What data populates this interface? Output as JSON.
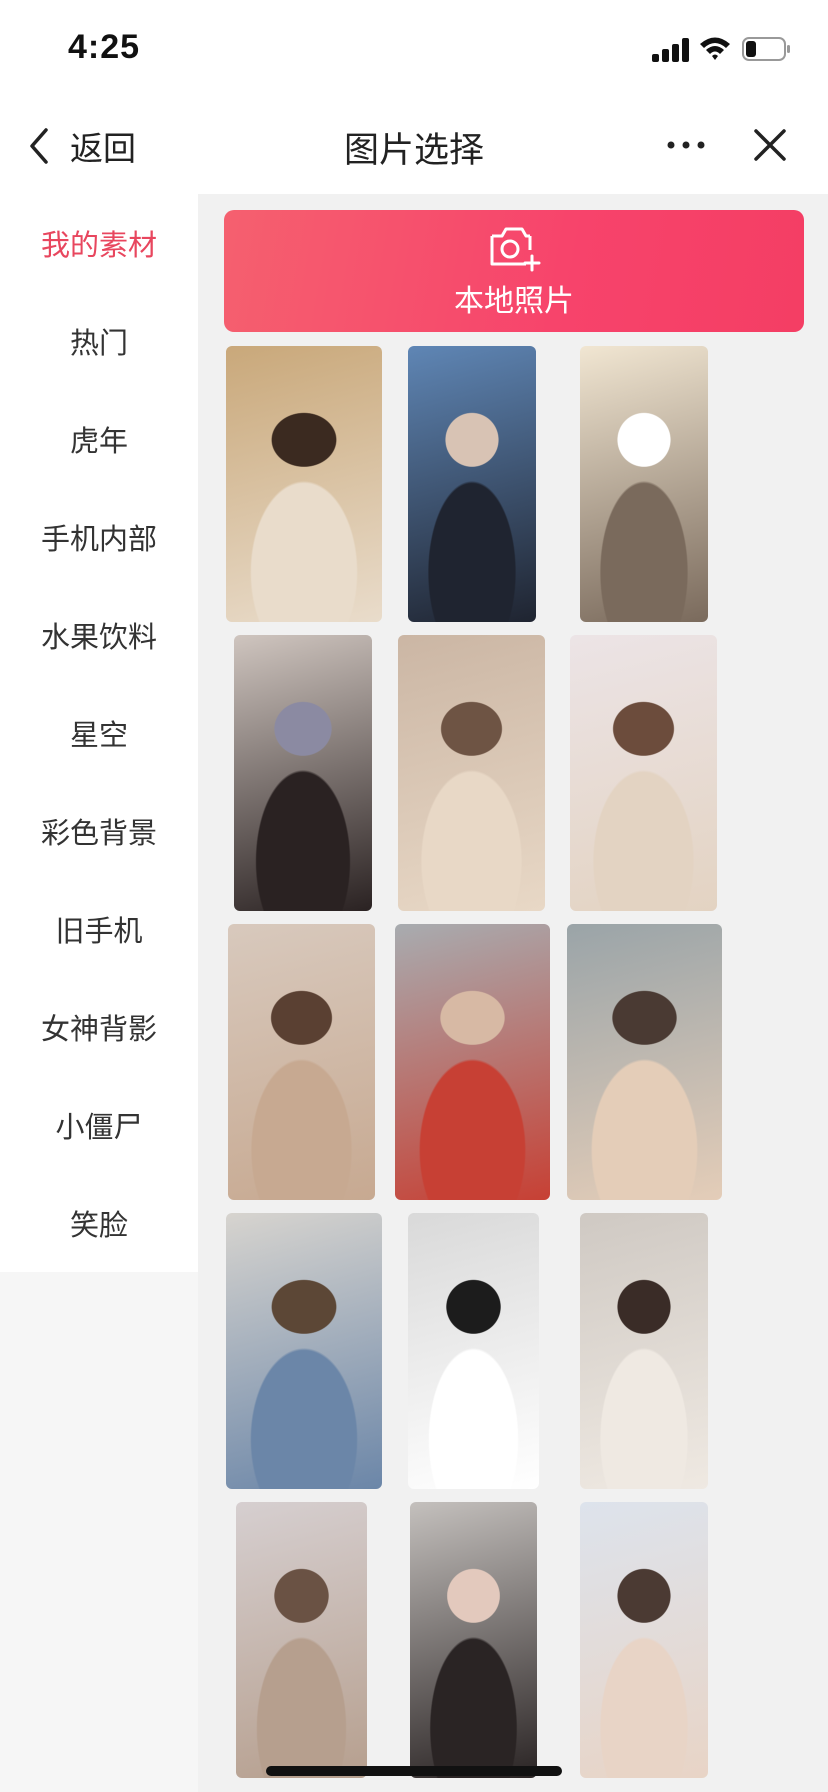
{
  "status_bar": {
    "time": "4:25"
  },
  "nav": {
    "back_label": "返回",
    "title": "图片选择"
  },
  "sidebar": {
    "active_color": "#e8465e",
    "items": [
      {
        "label": "我的素材",
        "active": true
      },
      {
        "label": "热门",
        "active": false
      },
      {
        "label": "虎年",
        "active": false
      },
      {
        "label": "手机内部",
        "active": false
      },
      {
        "label": "水果饮料",
        "active": false
      },
      {
        "label": "星空",
        "active": false
      },
      {
        "label": "彩色背景",
        "active": false
      },
      {
        "label": "旧手机",
        "active": false
      },
      {
        "label": "女神背影",
        "active": false
      },
      {
        "label": "小僵尸",
        "active": false
      },
      {
        "label": "笑脸",
        "active": false
      }
    ]
  },
  "local_photo": {
    "label": "本地照片",
    "icon": "camera-plus-icon",
    "color": "#f54a68"
  },
  "thumbnails": [
    {
      "name": "photo-1",
      "palette": [
        "#c9a87a",
        "#e9dccb",
        "#3b2a20"
      ]
    },
    {
      "name": "photo-2",
      "palette": [
        "#5f86b5",
        "#1f2430",
        "#d8c3b4"
      ]
    },
    {
      "name": "photo-3",
      "palette": [
        "#f1e6d2",
        "#7a6a5c",
        "#ffffff"
      ]
    },
    {
      "name": "photo-4",
      "palette": [
        "#cfc5bf",
        "#2a2222",
        "#8b8aa2"
      ]
    },
    {
      "name": "photo-5",
      "palette": [
        "#cbb6a4",
        "#e8d8c6",
        "#6e5444"
      ]
    },
    {
      "name": "photo-6",
      "palette": [
        "#ece4e6",
        "#e3d3c2",
        "#6c4c3c"
      ]
    },
    {
      "name": "photo-7",
      "palette": [
        "#d8c9bd",
        "#c7a991",
        "#5a4032"
      ]
    },
    {
      "name": "photo-8",
      "palette": [
        "#a8acb0",
        "#c74034",
        "#d7b9a4"
      ]
    },
    {
      "name": "photo-9",
      "palette": [
        "#9aa4a8",
        "#e4cdb8",
        "#4a3a33"
      ]
    },
    {
      "name": "photo-10",
      "palette": [
        "#d7d4cf",
        "#6b86a8",
        "#5c4736"
      ]
    },
    {
      "name": "photo-11",
      "palette": [
        "#d9d9d9",
        "#ffffff",
        "#1c1c1c"
      ]
    },
    {
      "name": "photo-12",
      "palette": [
        "#cfc9c3",
        "#efe9e2",
        "#3a2c27"
      ]
    },
    {
      "name": "photo-13",
      "palette": [
        "#d6cfd0",
        "#b69f8e",
        "#6a5244"
      ]
    },
    {
      "name": "photo-14",
      "palette": [
        "#c4c0bd",
        "#2a2424",
        "#e3c9bd"
      ]
    },
    {
      "name": "photo-15",
      "palette": [
        "#dde3ec",
        "#e8d4c6",
        "#4b3a33"
      ]
    }
  ]
}
